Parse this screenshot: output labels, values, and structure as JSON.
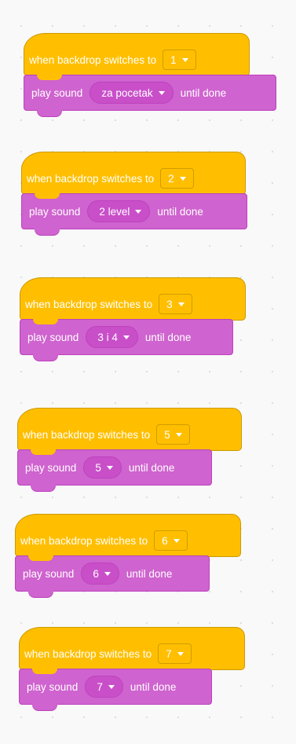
{
  "scripts": [
    {
      "hat_label": "when backdrop switches to",
      "backdrop_value": "1",
      "play_label": "play sound",
      "sound_value": "za pocetak",
      "until_label": "until done"
    },
    {
      "hat_label": "when backdrop switches to",
      "backdrop_value": "2",
      "play_label": "play sound",
      "sound_value": "2 level",
      "until_label": "until done"
    },
    {
      "hat_label": "when backdrop switches to",
      "backdrop_value": "3",
      "play_label": "play sound",
      "sound_value": "3 i 4",
      "until_label": "until done"
    },
    {
      "hat_label": "when backdrop switches to",
      "backdrop_value": "5",
      "play_label": "play sound",
      "sound_value": "5",
      "until_label": "until done"
    },
    {
      "hat_label": "when backdrop switches to",
      "backdrop_value": "6",
      "play_label": "play sound",
      "sound_value": "6",
      "until_label": "until done"
    },
    {
      "hat_label": "when backdrop switches to",
      "backdrop_value": "7",
      "play_label": "play sound",
      "sound_value": "7",
      "until_label": "until done"
    }
  ],
  "colors": {
    "events_block": "#ffbf00",
    "sound_block": "#cf63cf",
    "workspace": "#f9f9f9"
  }
}
